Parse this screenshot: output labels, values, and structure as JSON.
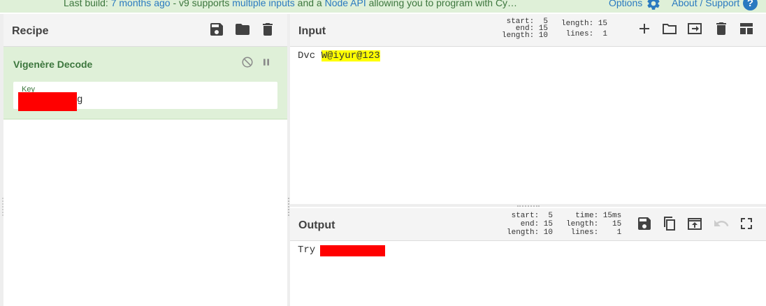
{
  "banner": {
    "prefix": "Last build: ",
    "build_age": "7 months ago",
    "middle": " - v9 supports ",
    "link_multiple": "multiple inputs",
    "and": " and a ",
    "link_node": "Node API",
    "suffix": " allowing you to program with Cy…",
    "options_label": "Options",
    "about_label": "About / Support",
    "help_glyph": "?"
  },
  "recipe": {
    "title": "Recipe",
    "operation": {
      "name": "Vigenère Decode",
      "arg_label": "Key",
      "arg_value_visible": "g"
    }
  },
  "input": {
    "title": "Input",
    "stats": {
      "start_row": "start:  5",
      "end_row": "end: 15",
      "length_row": "length: 10",
      "total_length_row": "length: 15",
      "lines_row": "lines:  1"
    },
    "text_plain": "Dvc ",
    "text_selected": "W@iyur@123"
  },
  "output": {
    "title": "Output",
    "stats": {
      "start_row": "start:  5",
      "end_row": "end: 15",
      "length_row": "length: 10",
      "time_row": "time: 15ms",
      "total_length_row": "length:   15",
      "lines_row": "lines:    1"
    },
    "text_visible": "Try "
  },
  "colors": {
    "banner_bg": "#dff0d8",
    "op_bg": "#dff0d8",
    "op_text": "#3c763d",
    "link": "#2a7ac0",
    "highlight": "#ffff00",
    "redaction": "#ff0000"
  },
  "icons": [
    "gear-icon",
    "help-icon",
    "save-icon",
    "folder-icon",
    "trash-icon",
    "disable-icon",
    "pause-icon",
    "plus-icon",
    "input-tab-icon",
    "layout-icon",
    "copy-icon",
    "replace-input-icon",
    "undo-icon",
    "maximize-icon"
  ]
}
